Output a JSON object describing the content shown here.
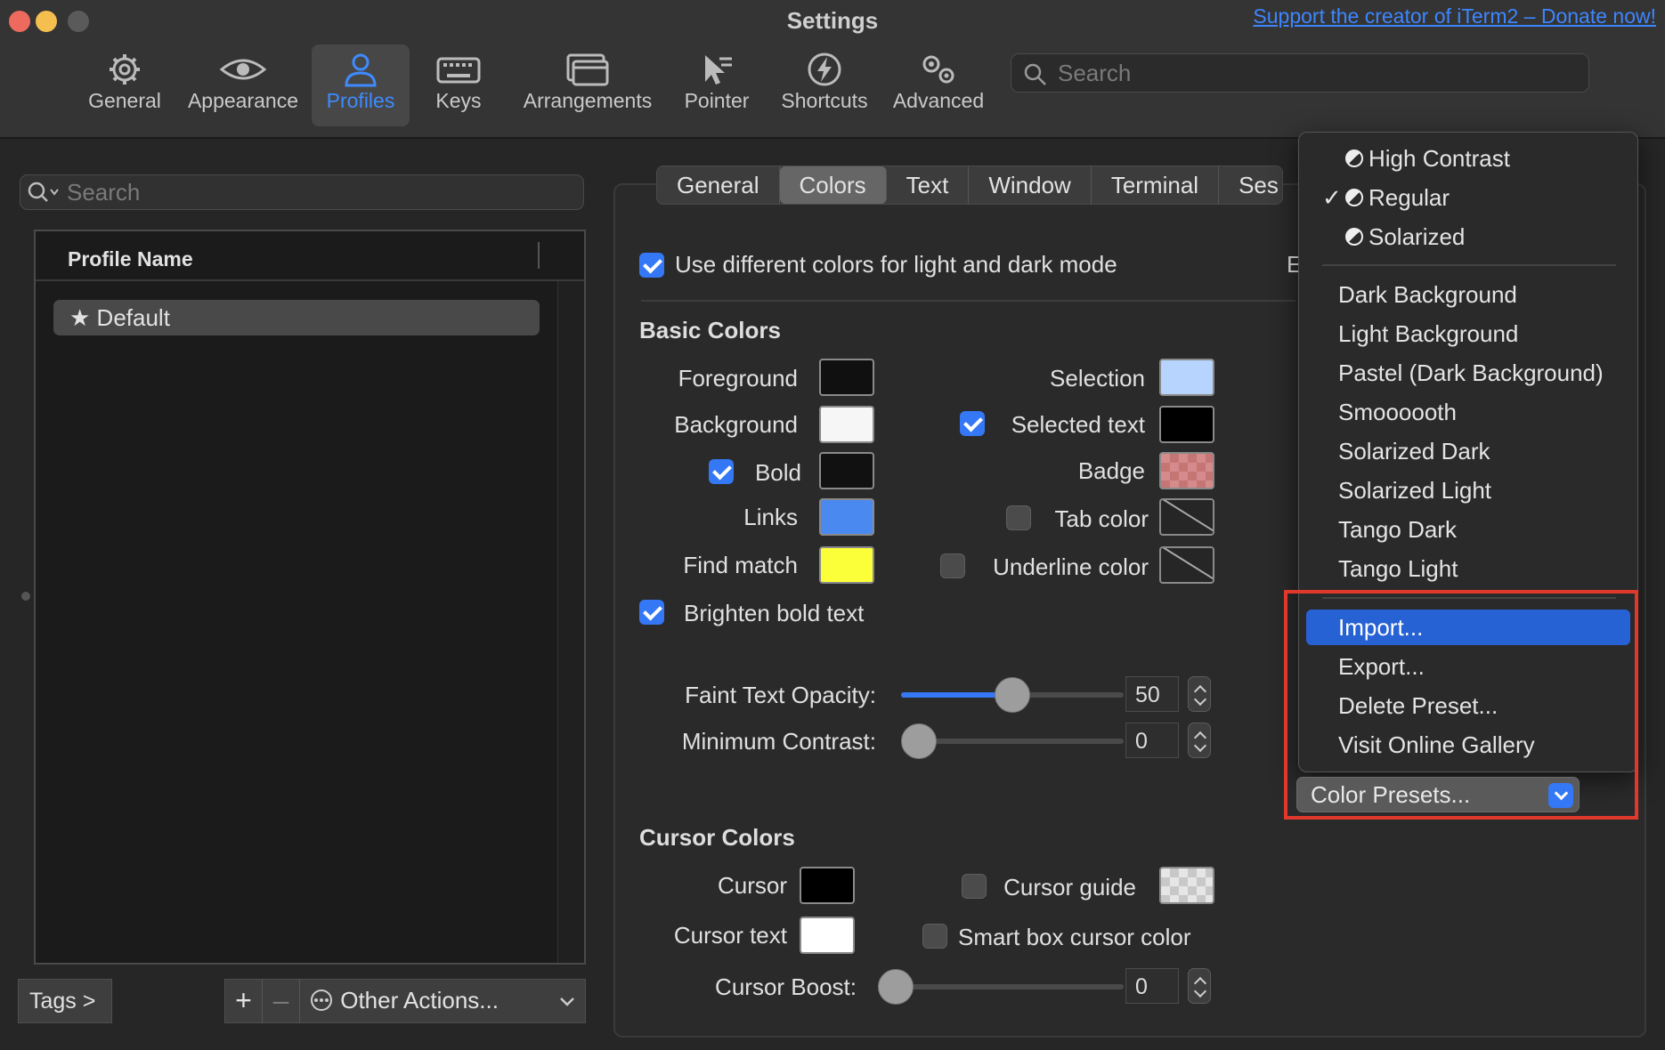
{
  "window": {
    "title": "Settings",
    "donate_link": "Support the creator of iTerm2 – Donate now!"
  },
  "toolbar": {
    "items": [
      {
        "label": "General",
        "icon": "gear-icon"
      },
      {
        "label": "Appearance",
        "icon": "eye-icon"
      },
      {
        "label": "Profiles",
        "icon": "person-icon"
      },
      {
        "label": "Keys",
        "icon": "keyboard-icon"
      },
      {
        "label": "Arrangements",
        "icon": "windows-icon"
      },
      {
        "label": "Pointer",
        "icon": "pointer-icon"
      },
      {
        "label": "Shortcuts",
        "icon": "bolt-icon"
      },
      {
        "label": "Advanced",
        "icon": "gears-icon"
      }
    ],
    "active": "Profiles",
    "search_placeholder": "Search"
  },
  "sidebar": {
    "search_placeholder": "Search",
    "column_header": "Profile Name",
    "profiles": [
      {
        "name": "Default",
        "star": "★"
      }
    ],
    "tags_button": "Tags >",
    "add": "+",
    "remove": "–",
    "other_actions": "Other Actions..."
  },
  "tabs": [
    "General",
    "Colors",
    "Text",
    "Window",
    "Terminal",
    "Ses"
  ],
  "active_tab": "Colors",
  "colors": {
    "use_different_label": "Use different colors for light and dark mode",
    "use_different_checked": true,
    "clipped_char": "E",
    "basic_heading": "Basic Colors",
    "foreground": "Foreground",
    "background": "Background",
    "bold": "Bold",
    "links": "Links",
    "find_match": "Find match",
    "selection": "Selection",
    "selected_text": "Selected text",
    "badge": "Badge",
    "tab_color": "Tab color",
    "underline_color": "Underline color",
    "brighten_bold": "Brighten bold text",
    "faint_label": "Faint Text Opacity:",
    "faint_value": "50",
    "faint_fraction": 0.5,
    "min_contrast_label": "Minimum Contrast:",
    "min_contrast_value": "0",
    "cursor_heading": "Cursor Colors",
    "cursor": "Cursor",
    "cursor_text": "Cursor text",
    "cursor_guide": "Cursor guide",
    "smart_box": "Smart box cursor color",
    "cursor_boost_label": "Cursor Boost:",
    "cursor_boost_value": "0",
    "swatch_colors": {
      "foreground": "#101010",
      "background": "#f6f6f6",
      "bold": "#111111",
      "links": "#4a8af0",
      "find_match": "#fbff3a",
      "selection": "#b7d4ff",
      "selected_text": "#000000",
      "cursor": "#000000",
      "cursor_text": "#ffffff"
    }
  },
  "menu": {
    "theme_items": [
      "High Contrast",
      "Regular",
      "Solarized"
    ],
    "checked": "Regular",
    "check_mark": "✓",
    "presets": [
      "Dark Background",
      "Light Background",
      "Pastel (Dark Background)",
      "Smoooooth",
      "Solarized Dark",
      "Solarized Light",
      "Tango Dark",
      "Tango Light"
    ],
    "actions": [
      "Import...",
      "Export...",
      "Delete Preset...",
      "Visit Online Gallery"
    ],
    "highlighted": "Import..."
  },
  "color_presets_button": "Color Presets..."
}
